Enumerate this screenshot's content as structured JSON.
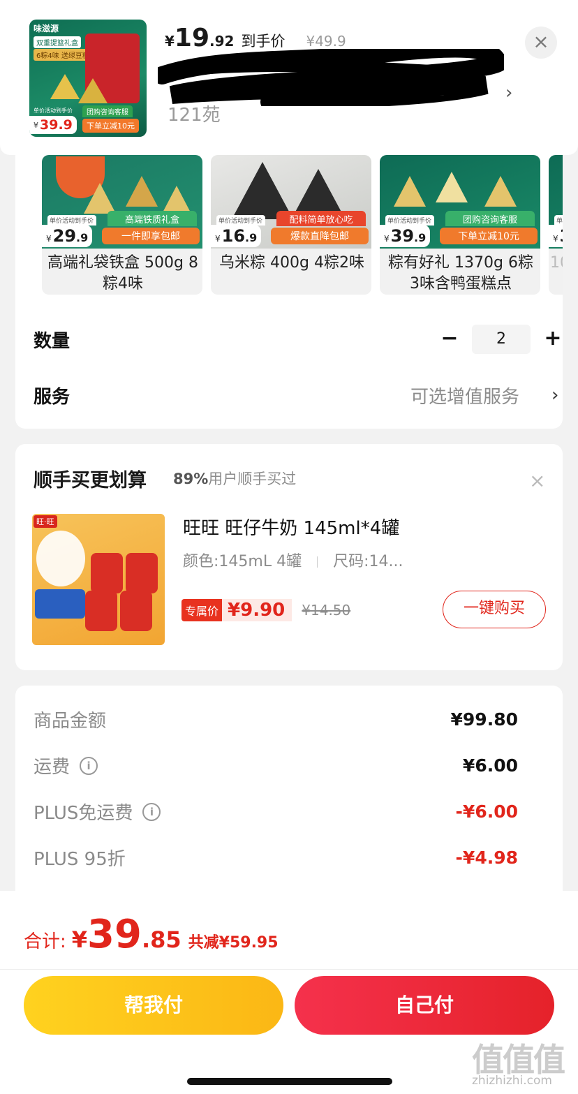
{
  "header": {
    "price_yen": "¥",
    "price_int": "19",
    "price_dec": ".92",
    "price_label": "到手价",
    "original_price": "¥49.9",
    "close_icon": "×",
    "chevron": "›",
    "subtitle": "121苑",
    "thumb": {
      "brand": "味滋源",
      "tag1": "双重提篮礼盒",
      "tag2": "6粽4味 送绿豆糕",
      "mini": "单价活动到手价",
      "price_yen": "¥",
      "price": "39.9",
      "promo_a": "团购咨询客服",
      "promo_b": "下单立减10元"
    }
  },
  "options": [
    {
      "label": "单价活动到手价",
      "yen": "¥",
      "price_int": "29",
      "price_dec": ".9",
      "tag_top": "高端铁质礼盒",
      "tag_bot": "一件即享包邮",
      "title": "高端礼袋铁盒 500g 8粽4味"
    },
    {
      "label": "单价活动到手价",
      "yen": "¥",
      "price_int": "16",
      "price_dec": ".9",
      "tag_top": "配料简单放心吃",
      "tag_bot": "爆款直降包邮",
      "title": "乌米粽 400g  4粽2味"
    },
    {
      "label": "单价活动到手价",
      "yen": "¥",
      "price_int": "39",
      "price_dec": ".9",
      "tag_top": "团购咨询客服",
      "tag_bot": "下单立减10元",
      "title": "粽有好礼 1370g  6粽3味含鸭蛋糕点"
    },
    {
      "label": "单价活动到手价",
      "yen": "¥",
      "price_int": "3",
      "price_dec": "",
      "tag_top": "",
      "tag_bot": "",
      "title": "10"
    }
  ],
  "quantity": {
    "label": "数量",
    "value": "2",
    "minus": "−",
    "plus": "+"
  },
  "service": {
    "label": "服务",
    "value": "可选增值服务",
    "chevron": "›"
  },
  "addon": {
    "title": "顺手买更划算",
    "subtitle_pct": "89%",
    "subtitle_rest": "用户顺手买过",
    "close_icon": "×",
    "img_tag": "旺·旺",
    "name": "旺旺 旺仔牛奶 145ml*4罐",
    "spec_color": "颜色:145mL 4罐",
    "spec_size": "尺码:14...",
    "price_badge": "专属价",
    "price": "¥9.90",
    "original_price": "¥14.50",
    "buy_button": "一键购买"
  },
  "summary": {
    "rows": [
      {
        "label": "商品金额",
        "value": "¥99.80",
        "info": false,
        "red": false
      },
      {
        "label": "运费",
        "value": "¥6.00",
        "info": true,
        "red": false
      },
      {
        "label": "PLUS免运费",
        "value": "-¥6.00",
        "info": true,
        "red": true
      },
      {
        "label": "PLUS 95折",
        "value": "-¥4.98",
        "info": false,
        "red": true
      }
    ],
    "info_icon": "i"
  },
  "footer": {
    "total_label": "合计:",
    "total_yen": "¥",
    "total_int": "39",
    "total_dec": ".85",
    "saving": "共减¥59.95",
    "help_pay": "帮我付",
    "self_pay": "自己付"
  },
  "watermark": {
    "text": "值值值",
    "sub": "zhizhizhi.com"
  },
  "colors": {
    "accent_red": "#e1251b",
    "help_yellow": "#fbb715",
    "self_red": "#e5222a"
  }
}
